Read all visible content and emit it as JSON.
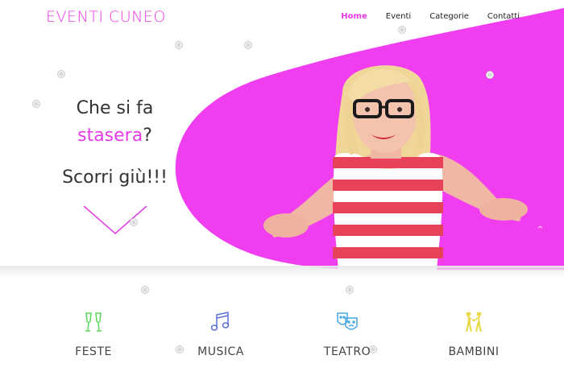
{
  "brand": "EVENTI CUNEO",
  "nav": [
    {
      "label": "Home",
      "active": true
    },
    {
      "label": "Eventi",
      "active": false
    },
    {
      "label": "Categorie",
      "active": false
    },
    {
      "label": "Contatti",
      "active": false
    }
  ],
  "hero": {
    "line1": "Che si fa",
    "highlight": "stasera",
    "question_mark": "?",
    "scroll": "Scorri giù!!!"
  },
  "categories": [
    {
      "label": "FESTE",
      "icon": "champagne-glasses-icon",
      "color": "#5cd65c"
    },
    {
      "label": "MUSICA",
      "icon": "music-note-icon",
      "color": "#5b6fd6"
    },
    {
      "label": "TEATRO",
      "icon": "theater-masks-icon",
      "color": "#4aa6e0"
    },
    {
      "label": "BAMBINI",
      "icon": "children-icon",
      "color": "#e8d84a"
    }
  ],
  "colors": {
    "accent": "#e63be6"
  }
}
